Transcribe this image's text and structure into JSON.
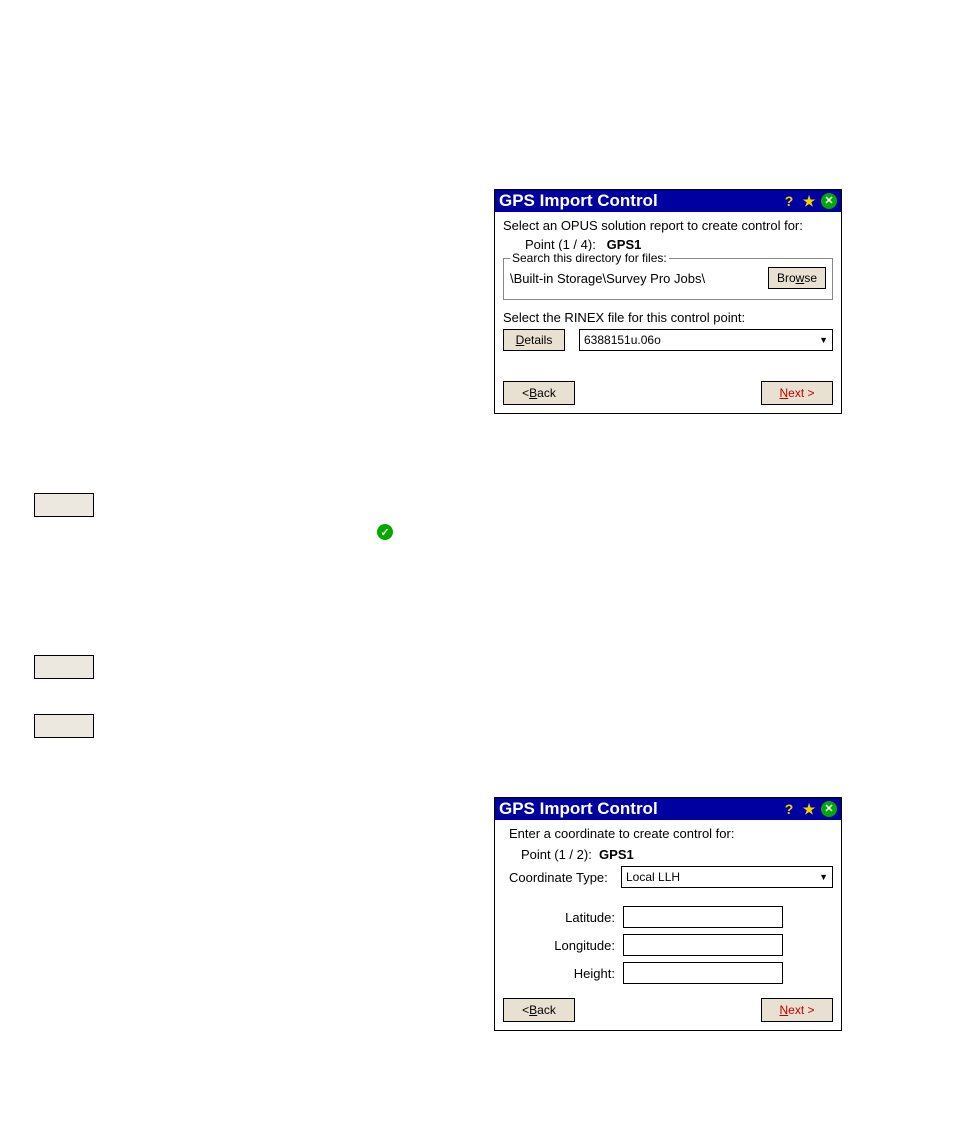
{
  "dialog1": {
    "title": "GPS Import Control",
    "prompt": "Select an OPUS solution report to create control for:",
    "point_label": "Point (1 / 4):",
    "point_name": "GPS1",
    "search_legend": "Search this directory for files:",
    "search_path": "\\Built-in Storage\\Survey Pro Jobs\\",
    "browse_prefix": "Bro",
    "browse_hot": "w",
    "browse_suffix": "se",
    "select_rinex": "Select the RINEX file for this control point:",
    "details_hot": "D",
    "details_suffix": "etails",
    "rinex_value": "6388151u.06o",
    "back_lt": "< ",
    "back_hot": "B",
    "back_suffix": "ack",
    "next_hot": "N",
    "next_suffix": "ext >"
  },
  "dialog2": {
    "title": "GPS Import Control",
    "prompt": "Enter a coordinate to create control for:",
    "point_label": "Point (1 / 2):",
    "point_name": "GPS1",
    "coord_type_label": "Coordinate Type:",
    "coord_type_value": "Local LLH",
    "lat_label": "Latitude:",
    "lon_label": "Longitude:",
    "height_label": "Height:",
    "back_lt": "< ",
    "back_hot": "B",
    "back_suffix": "ack",
    "next_hot": "N",
    "next_suffix": "ext >"
  },
  "titlebar_icons": {
    "help": "?",
    "star": "★",
    "close": "✕"
  },
  "check_glyph": "✓"
}
